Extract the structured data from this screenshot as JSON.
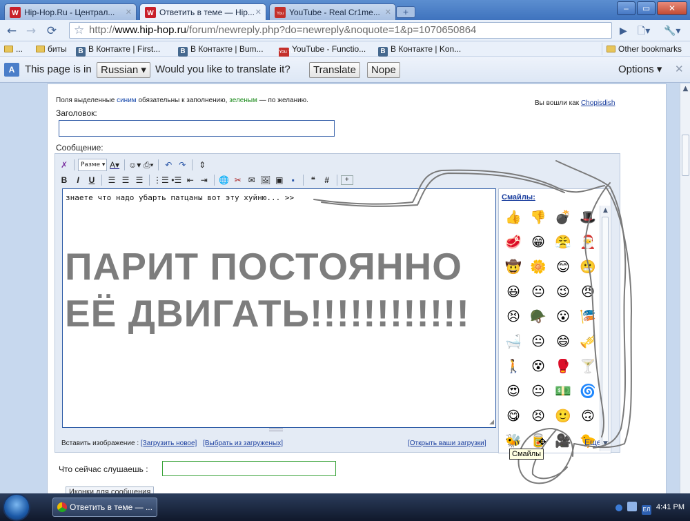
{
  "tabs": [
    {
      "title": "Hip-Hop.Ru - Централ..."
    },
    {
      "title": "Ответить в теме — Hip..."
    },
    {
      "title": "YouTube - Real Cr1me..."
    }
  ],
  "address": {
    "scheme": "http://",
    "host": "www.hip-hop.ru",
    "path": "/forum/newreply.php?do=newreply&noquote=1&p=1070650864"
  },
  "bookmarks": {
    "items": [
      {
        "label": "..."
      },
      {
        "label": "биты"
      },
      {
        "label": "В Контакте | First..."
      },
      {
        "label": "В Контакте | Bum..."
      },
      {
        "label": "YouTube - Functio..."
      },
      {
        "label": "В Контакте | Kon..."
      }
    ],
    "other": "Other bookmarks",
    "vk_letter": "B",
    "yt_text": "You Tube"
  },
  "translate_bar": {
    "text": "This page is in",
    "language": "Russian ▾",
    "question": "Would you like to translate it?",
    "translate": "Translate",
    "nope": "Nope",
    "options": "Options ▾"
  },
  "form": {
    "required_prefix": "Поля выделенные",
    "required_blue": "синим",
    "required_mid": "обязательны к заполнению,",
    "required_green": "зеленым",
    "required_suffix": "— по желанию.",
    "logged_in_prefix": "Вы вошли как",
    "username": "Chopisdish",
    "title_label": "Заголовок:",
    "message_label": "Сообщение:",
    "size_select": "Разме ▾",
    "message_text": "знаете что надо убарть патцаны вот эту хуйню... >>",
    "overlay_line1": "ПАРИТ ПОСТОЯННО",
    "overlay_line2": "ЕЁ ДВИГАТЬ!!!!!!!!!!!!",
    "smileys_header": "Смайлы:",
    "smileys_more": "Еще",
    "tooltip": "Смайлы",
    "insert_image_label": "Вставить изображение :",
    "upload_new": "[Загрузить новое]",
    "choose_uploaded": "[Выбрать из загруженых]",
    "open_uploads": "[Открыть ваши загрузки]",
    "listening_label": "Что сейчас слушаешь :",
    "icons_button": "Иконки для сообщения"
  },
  "smileys": [
    "👍",
    "👎",
    "💣",
    "🎩",
    "🥩",
    "😁",
    "😤",
    "🎅",
    "🤠",
    "🌼",
    "😊",
    "😬",
    "😃",
    "😐",
    "😉",
    "😠",
    "😣",
    "🪖",
    "😮",
    "🎏",
    "🛁",
    "😐",
    "😄",
    "🎺",
    "🚶",
    "😵",
    "🥊",
    "🍸",
    "😍",
    "😐",
    "💵",
    "🌀",
    "😋",
    "😣",
    "🙂",
    "🙃",
    "🐝",
    "🥫",
    "🎥",
    "🐤",
    "👹",
    "😂",
    "👮",
    "⚓"
  ],
  "taskbar": {
    "item": "Ответить в теме — ...",
    "clock": "4:41 PM",
    "tray_badge": "ЕЛ"
  },
  "colors": {
    "accent": "#345fa8",
    "overlay": "#7d7d7d",
    "scribble": "#7a7a7a"
  }
}
